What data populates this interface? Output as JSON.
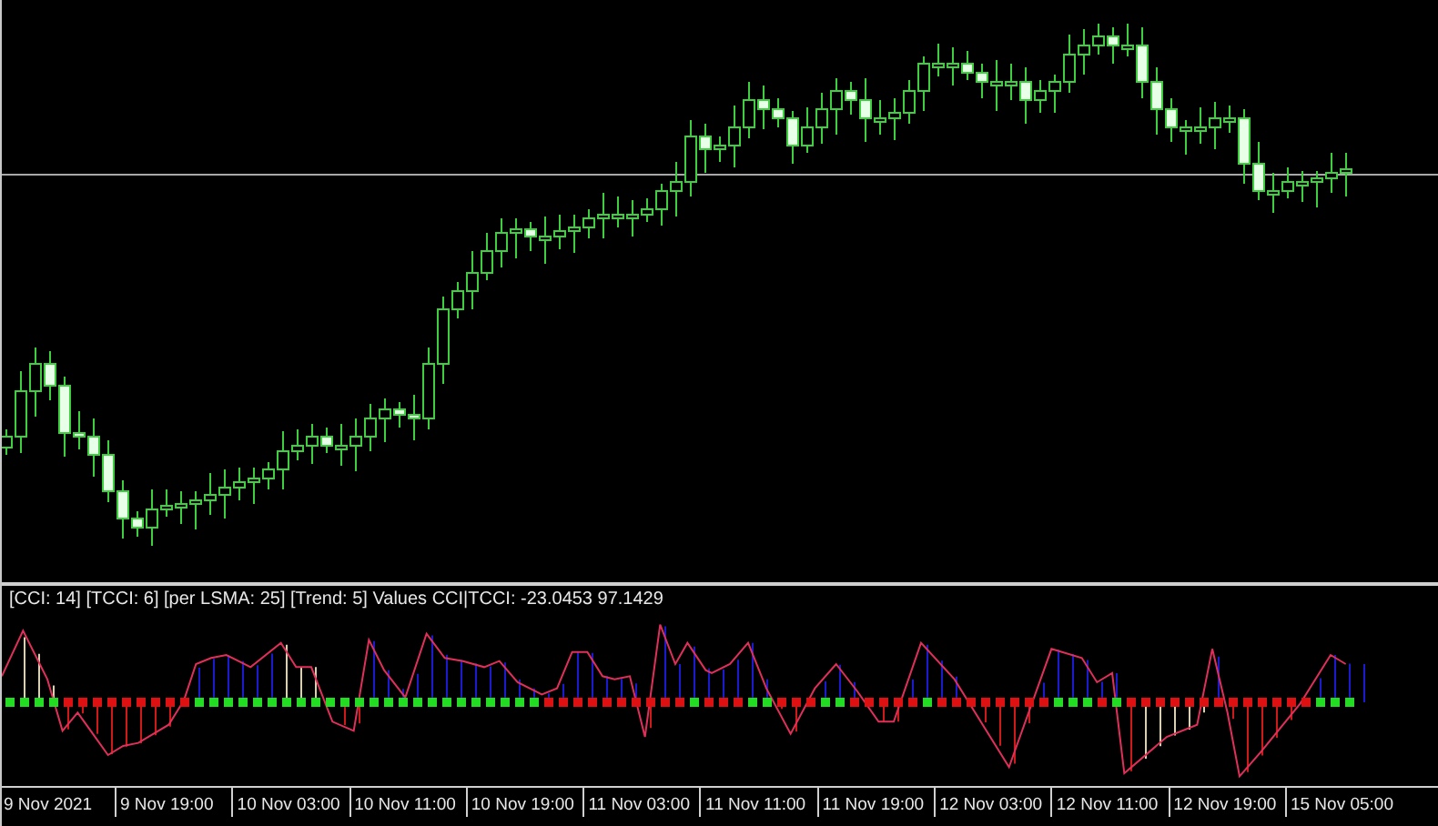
{
  "indicator_panel": {
    "legend": "[CCI: 14] [TCCI: 6] [per LSMA: 25] [Trend: 5] Values CCI|TCCI: -23.0453 97.1429"
  },
  "time_axis": {
    "labels": [
      "9 Nov 2021",
      "9 Nov 19:00",
      "10 Nov 03:00",
      "10 Nov 11:00",
      "10 Nov 19:00",
      "11 Nov 03:00",
      "11 Nov 11:00",
      "11 Nov 19:00",
      "12 Nov 03:00",
      "12 Nov 11:00",
      "12 Nov 19:00",
      "15 Nov 05:00"
    ]
  }
}
